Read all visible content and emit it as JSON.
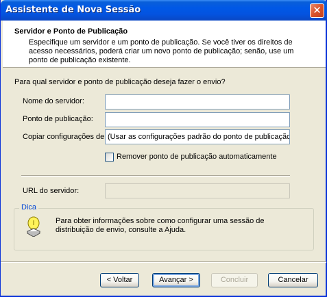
{
  "window": {
    "title": "Assistente de Nova Sessão"
  },
  "header": {
    "title": "Servidor e Ponto de Publicação",
    "description": "Especifique um servidor e um ponto de publicação. Se você tiver os direitos de acesso necessários, poderá criar um novo ponto de publicação; senão, use um ponto de publicação existente."
  },
  "form": {
    "question": "Para qual servidor e ponto de publicação deseja fazer o envio?",
    "server_label": "Nome do servidor:",
    "server_value": "",
    "publishing_point_label": "Ponto de publicação:",
    "publishing_point_value": "",
    "copy_settings_label": "Copiar configurações de:",
    "copy_settings_value": "(Usar as configurações padrão do ponto de publicação)",
    "auto_remove_label": "Remover ponto de publicação automaticamente",
    "auto_remove_checked": false,
    "server_url_label": "URL do servidor:",
    "server_url_value": ""
  },
  "tip": {
    "title": "Dica",
    "icon": "lightbulb-hint-icon",
    "text": "Para obter informações sobre como configurar uma sessão de distribuição de envio, consulte a Ajuda."
  },
  "buttons": {
    "back": "< Voltar",
    "next": "Avançar >",
    "finish": "Concluir",
    "cancel": "Cancelar"
  }
}
